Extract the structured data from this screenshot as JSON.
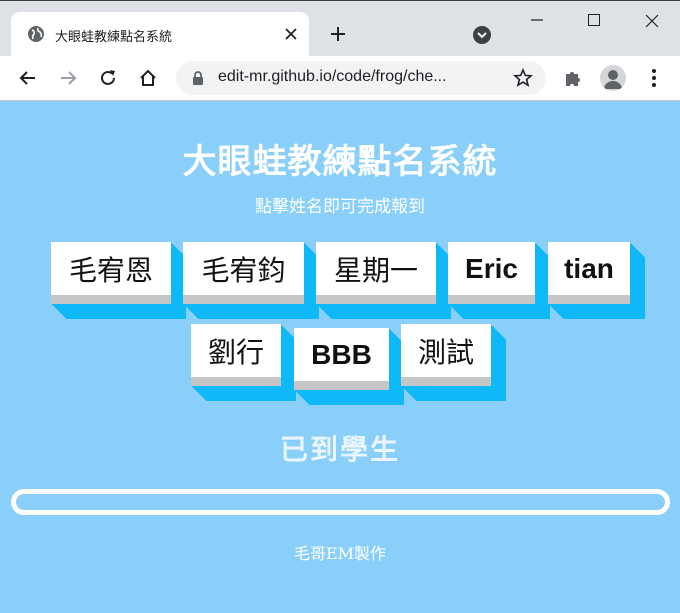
{
  "browser": {
    "tab_title": "大眼蛙教練點名系統",
    "url": "edit-mr.github.io/code/frog/che..."
  },
  "page": {
    "title": "大眼蛙教練點名系統",
    "subtitle": "點擊姓名即可完成報到",
    "students": [
      "毛宥恩",
      "毛宥鈞",
      "星期一",
      "Eric",
      "tian",
      "劉行",
      "BBB",
      "測試"
    ],
    "arrived_heading": "已到學生",
    "footer": "毛哥EM製作"
  },
  "colors": {
    "background": "#89cff9",
    "button_shadow": "#0fb8f6",
    "button_face": "#ffffff"
  }
}
